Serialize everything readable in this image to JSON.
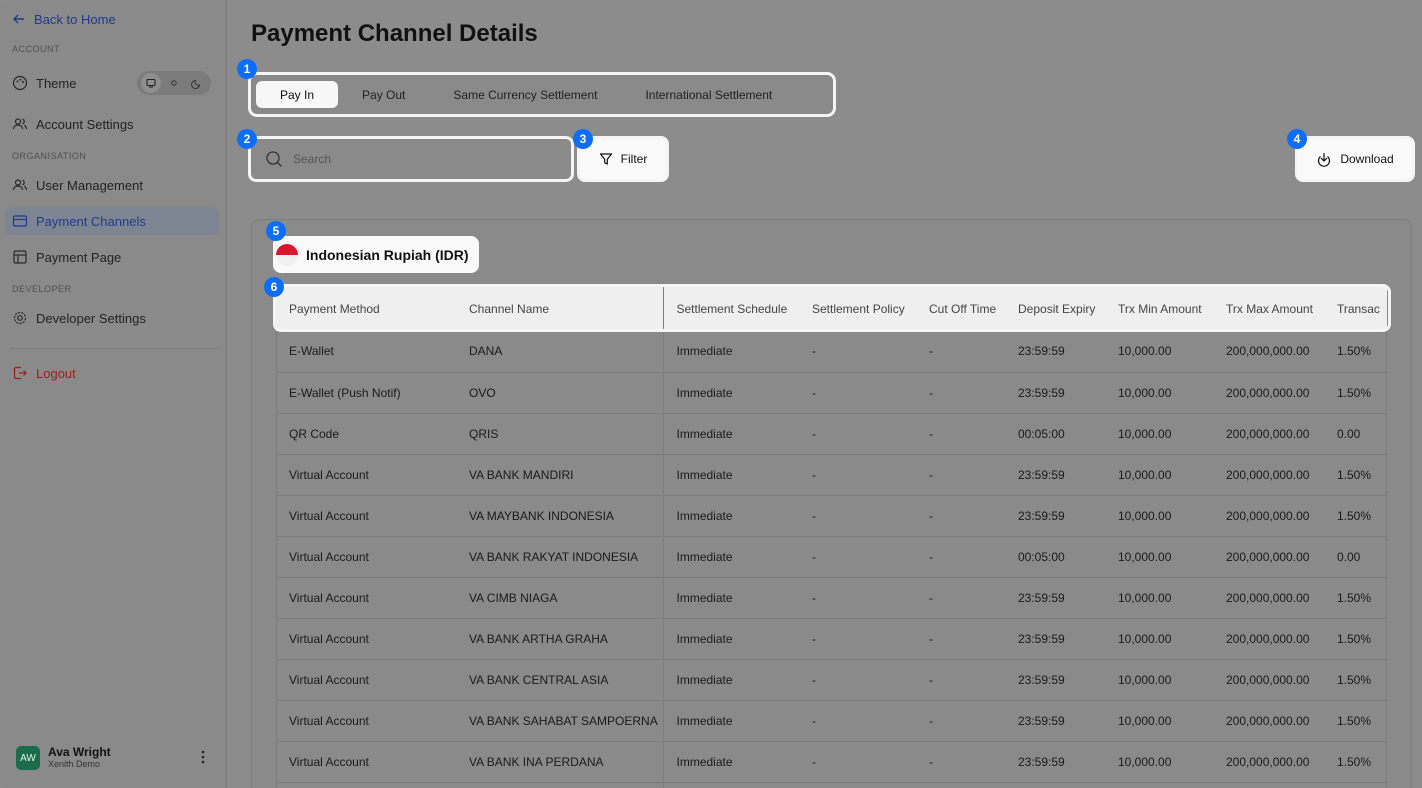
{
  "sidebar": {
    "back_label": "Back to Home",
    "sections": {
      "account": "ACCOUNT",
      "organisation": "ORGANISATION",
      "developer": "DEVELOPER"
    },
    "items": [
      {
        "label": "Theme"
      },
      {
        "label": "Account Settings"
      },
      {
        "label": "User Management"
      },
      {
        "label": "Payment Channels"
      },
      {
        "label": "Payment Page"
      },
      {
        "label": "Developer Settings"
      },
      {
        "label": "Logout"
      }
    ],
    "user": {
      "initials": "AW",
      "name": "Ava Wright",
      "org": "Xenith Demo"
    }
  },
  "main": {
    "title": "Payment Channel Details",
    "tabs": [
      {
        "label": "Pay In",
        "active": true
      },
      {
        "label": "Pay Out"
      },
      {
        "label": "Same Currency Settlement"
      },
      {
        "label": "International Settlement"
      }
    ],
    "search": {
      "placeholder": "Search",
      "value": ""
    },
    "filter_label": "Filter",
    "download_label": "Download",
    "currency": "Indonesian Rupiah (IDR)",
    "markers": [
      "1",
      "2",
      "3",
      "4",
      "5",
      "6"
    ],
    "table": {
      "columns": [
        "Payment Method",
        "Channel Name",
        "Settlement Schedule",
        "Settlement Policy",
        "Cut Off Time",
        "Deposit Expiry",
        "Trx Min Amount",
        "Trx Max Amount",
        "Transac"
      ],
      "rows": [
        [
          "E-Wallet",
          "DANA",
          "Immediate",
          "-",
          "-",
          "23:59:59",
          "10,000.00",
          "200,000,000.00",
          "1.50%"
        ],
        [
          "E-Wallet (Push Notif)",
          "OVO",
          "Immediate",
          "-",
          "-",
          "23:59:59",
          "10,000.00",
          "200,000,000.00",
          "1.50%"
        ],
        [
          "QR Code",
          "QRIS",
          "Immediate",
          "-",
          "-",
          "00:05:00",
          "10,000.00",
          "200,000,000.00",
          "0.00"
        ],
        [
          "Virtual Account",
          "VA BANK MANDIRI",
          "Immediate",
          "-",
          "-",
          "23:59:59",
          "10,000.00",
          "200,000,000.00",
          "1.50%"
        ],
        [
          "Virtual Account",
          "VA MAYBANK INDONESIA",
          "Immediate",
          "-",
          "-",
          "23:59:59",
          "10,000.00",
          "200,000,000.00",
          "1.50%"
        ],
        [
          "Virtual Account",
          "VA BANK RAKYAT INDONESIA",
          "Immediate",
          "-",
          "-",
          "00:05:00",
          "10,000.00",
          "200,000,000.00",
          "0.00"
        ],
        [
          "Virtual Account",
          "VA CIMB NIAGA",
          "Immediate",
          "-",
          "-",
          "23:59:59",
          "10,000.00",
          "200,000,000.00",
          "1.50%"
        ],
        [
          "Virtual Account",
          "VA BANK ARTHA GRAHA",
          "Immediate",
          "-",
          "-",
          "23:59:59",
          "10,000.00",
          "200,000,000.00",
          "1.50%"
        ],
        [
          "Virtual Account",
          "VA BANK CENTRAL ASIA",
          "Immediate",
          "-",
          "-",
          "23:59:59",
          "10,000.00",
          "200,000,000.00",
          "1.50%"
        ],
        [
          "Virtual Account",
          "VA BANK SAHABAT SAMPOERNA",
          "Immediate",
          "-",
          "-",
          "23:59:59",
          "10,000.00",
          "200,000,000.00",
          "1.50%"
        ],
        [
          "Virtual Account",
          "VA BANK INA PERDANA",
          "Immediate",
          "-",
          "-",
          "23:59:59",
          "10,000.00",
          "200,000,000.00",
          "1.50%"
        ],
        [
          "",
          "",
          "",
          "",
          "",
          "",
          "",
          "",
          ""
        ]
      ]
    }
  }
}
